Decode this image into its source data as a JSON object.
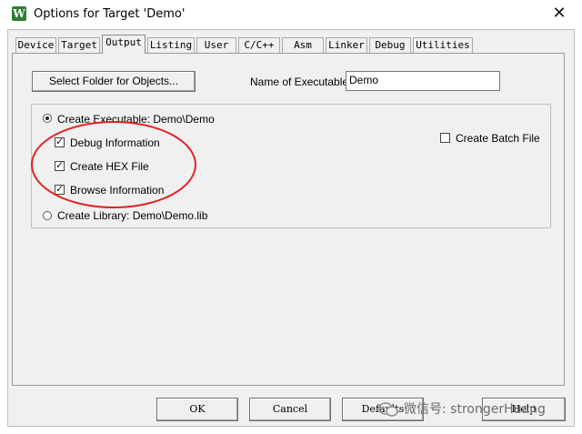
{
  "window": {
    "title": "Options for Target 'Demo'",
    "icon_letter": "W",
    "close_glyph": "✕"
  },
  "tabs": [
    {
      "label": "Device"
    },
    {
      "label": "Target"
    },
    {
      "label": "Output",
      "active": true
    },
    {
      "label": "Listing"
    },
    {
      "label": "User"
    },
    {
      "label": "C/C++"
    },
    {
      "label": "Asm"
    },
    {
      "label": "Linker"
    },
    {
      "label": "Debug"
    },
    {
      "label": "Utilities"
    }
  ],
  "output": {
    "select_folder_button": "Select Folder for Objects...",
    "name_label": "Name of Executable:",
    "name_value": "Demo",
    "create_executable_label": "Create Executable:  Demo\\Demo",
    "create_executable_selected": true,
    "debug_info_label": "Debug Information",
    "debug_info_checked": true,
    "create_hex_label": "Create HEX File",
    "create_hex_checked": true,
    "browse_info_label": "Browse Information",
    "browse_info_checked": true,
    "create_batch_label": "Create Batch File",
    "create_batch_checked": false,
    "create_library_label": "Create Library:  Demo\\Demo.lib",
    "create_library_selected": false
  },
  "footer": {
    "ok_label": "OK",
    "cancel_label": "Cancel",
    "defaults_label": "Defaults",
    "help_label": "Help"
  },
  "watermark": {
    "text": "微信号: strongerHuang"
  },
  "colors": {
    "annotation_ellipse": "#e02020",
    "app_icon": "#2f7d32"
  }
}
